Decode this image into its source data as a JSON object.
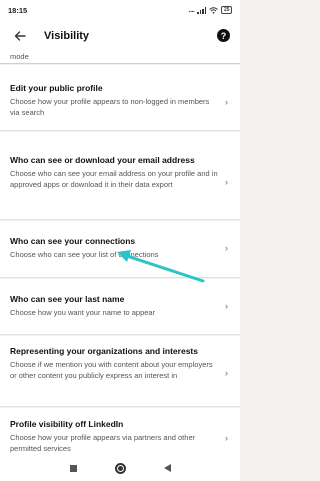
{
  "status_bar": {
    "time": "18:15",
    "signal_text": "....",
    "battery_level": "25"
  },
  "header": {
    "title": "Visibility",
    "back_icon": "arrow-left-icon",
    "help_icon": "question-circle-icon"
  },
  "items": [
    {
      "title": "",
      "description": "mode"
    },
    {
      "title": "Edit your public profile",
      "description": "Choose how your profile appears to non-logged in members via search"
    },
    {
      "title": "Who can see or download your email address",
      "description": "Choose who can see your email address on your profile and in approved apps or download it in their data export"
    },
    {
      "title": "Who can see your connections",
      "description": "Choose who can see your list of connections"
    },
    {
      "title": "Who can see your last name",
      "description": "Choose how you want your name to appear"
    },
    {
      "title": "Representing your organizations and interests",
      "description": "Choose if we mention you with content about your employers or other content you publicly express an interest in"
    },
    {
      "title": "Profile visibility off LinkedIn",
      "description": "Choose how your profile appears via partners and other permitted services"
    }
  ],
  "chevron_glyph": "›",
  "annotation": {
    "color": "#2ec4c4",
    "shape": "arrow"
  },
  "nav_bar": {
    "icons": [
      "square-icon",
      "home-circle-icon",
      "back-triangle-icon"
    ]
  }
}
